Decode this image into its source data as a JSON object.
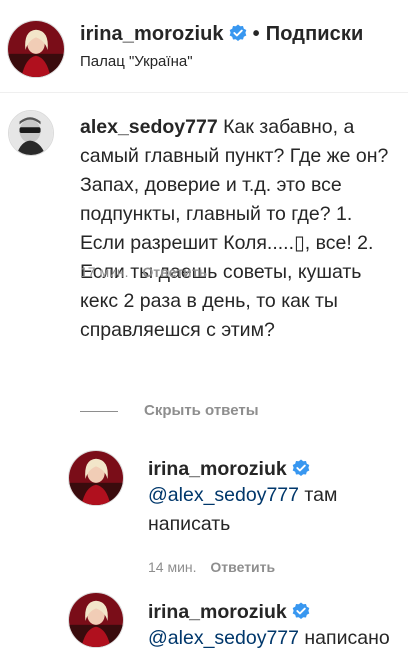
{
  "post_header": {
    "username": "irina_moroziuk",
    "separator": "•",
    "follow_label": "Подписки",
    "location": "Палац \"Україна\""
  },
  "comment": {
    "username": "alex_sedoy777",
    "text": "Как забавно, а самый главный пункт? Где же он? Запах, доверие и т.д. это все подпункты, главный то где? 1. Если разрешит Коля.....▯, все! 2. Если ты даешь советы, кушать кекс 2 раза в день, то как ты справляешся с этим?",
    "time": "17 мин.",
    "reply_label": "Ответить"
  },
  "hide_replies_label": "Скрыть ответы",
  "replies": [
    {
      "username": "irina_moroziuk",
      "mention": "@alex_sedoy777",
      "text": " там написать",
      "time": "14 мин.",
      "reply_label": "Ответить"
    },
    {
      "username": "irina_moroziuk",
      "mention": "@alex_sedoy777",
      "text": " написано"
    }
  ],
  "colors": {
    "text": "#262626",
    "secondary": "#8e8e8e",
    "mention": "#00376b",
    "verified": "#3897f0"
  }
}
